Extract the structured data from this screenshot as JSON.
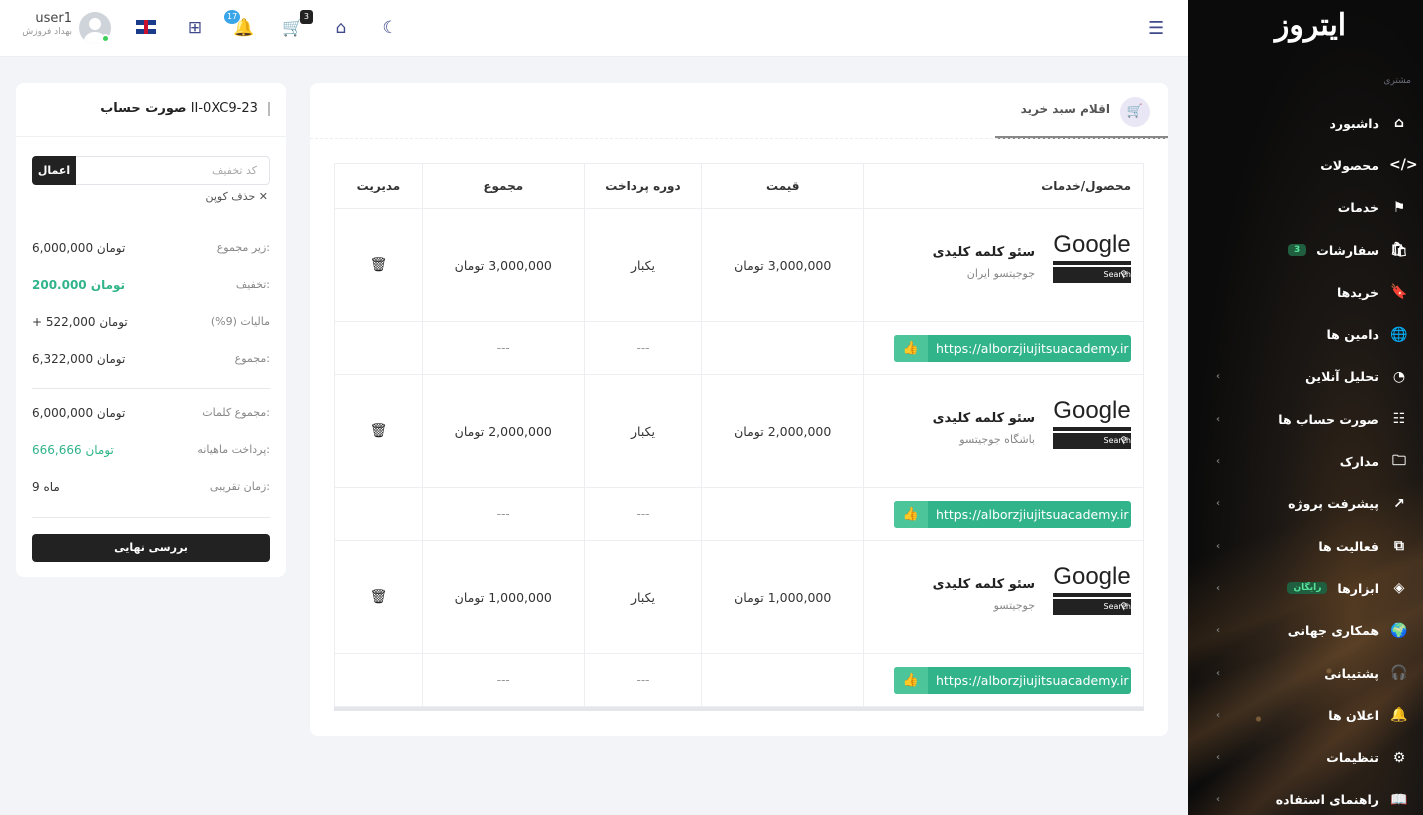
{
  "sidebar": {
    "logo": "ایتروز",
    "section": "مشتری",
    "items": [
      {
        "label": "داشبورد",
        "icon": "⌂",
        "icon_name": "home-icon"
      },
      {
        "label": "محصولات",
        "icon": "</>",
        "icon_name": "code-icon"
      },
      {
        "label": "خدمات",
        "icon": "⚑",
        "icon_name": "flag-icon"
      },
      {
        "label": "سفارشات",
        "icon": "🛍",
        "icon_name": "shopping-bag-icon",
        "badge": "3"
      },
      {
        "label": "خریدها",
        "icon": "🔖",
        "icon_name": "bookmark-icon"
      },
      {
        "label": "دامین ها",
        "icon": "🌐",
        "icon_name": "globe-icon"
      },
      {
        "label": "تحلیل آنلاین",
        "icon": "◔",
        "icon_name": "pie-chart-icon"
      },
      {
        "label": "صورت حساب ها",
        "icon": "☷",
        "icon_name": "invoice-icon"
      },
      {
        "label": "مدارک",
        "icon": "🗀",
        "icon_name": "folder-icon"
      },
      {
        "label": "پیشرفت پروژه",
        "icon": "↗",
        "icon_name": "trending-up-icon"
      },
      {
        "label": "فعالیت ها",
        "icon": "⧉",
        "icon_name": "activity-icon"
      },
      {
        "label": "ابزارها",
        "icon": "◈",
        "icon_name": "layers-icon",
        "badge": "رایگان"
      },
      {
        "label": "همکاری جهانی",
        "icon": "🌍",
        "icon_name": "world-icon"
      },
      {
        "label": "پشتیبانی",
        "icon": "🎧",
        "icon_name": "headset-icon"
      },
      {
        "label": "اعلان ها",
        "icon": "🔔",
        "icon_name": "bell-icon"
      },
      {
        "label": "تنظیمات",
        "icon": "⚙",
        "icon_name": "gear-icon"
      },
      {
        "label": "راهنمای استفاده",
        "icon": "📖",
        "icon_name": "book-icon"
      }
    ]
  },
  "topbar": {
    "cart_count": "3",
    "notif_count": "17",
    "user_name": "user1",
    "user_role": "بهداد فروزش"
  },
  "invoice": {
    "title_prefix": "صورت حساب",
    "invoice_id": "II-0XC9-23",
    "coupon_placeholder": "کد تخفیف",
    "coupon_apply": "اعمال",
    "coupon_remove": "حذف کوپن",
    "rows": [
      {
        "label": "زیر مجموع:",
        "value": "6,000,000 تومان"
      },
      {
        "label": "تخفیف:",
        "value": "200.000 تومان"
      },
      {
        "label": "مالیات (9%)",
        "value": "+ 522,000 تومان"
      },
      {
        "label": "مجموع:",
        "value": "6,322,000 تومان"
      }
    ],
    "rows2": [
      {
        "label": "مجموع کلمات:",
        "value": "6,000,000 تومان"
      },
      {
        "label": "پرداخت ماهیانه:",
        "value": "666,666 تومان"
      },
      {
        "label": "زمان تقریبی:",
        "value": "9 ماه"
      }
    ],
    "final_button": "بررسی نهایی"
  },
  "cart": {
    "tab_label": "اقلام سبد خرید",
    "columns": [
      "محصول/خدمات",
      "قیمت",
      "دوره پرداخت",
      "مجموع",
      "مدیریت"
    ],
    "items": [
      {
        "title": "سئو کلمه کلیدی",
        "subtitle": "جوجیتسو ایران",
        "price": "3,000,000 تومان",
        "period": "یکبار",
        "total": "3,000,000 تومان",
        "url": "https://alborzjiujitsuacademy.ir"
      },
      {
        "title": "سئو کلمه کلیدی",
        "subtitle": "باشگاه جوجیتسو",
        "price": "2,000,000 تومان",
        "period": "یکبار",
        "total": "2,000,000 تومان",
        "url": "https://alborzjiujitsuacademy.ir"
      },
      {
        "title": "سئو کلمه کلیدی",
        "subtitle": "جوجیتسو",
        "price": "1,000,000 تومان",
        "period": "یکبار",
        "total": "1,000,000 تومان",
        "url": "https://alborzjiujitsuacademy.ir"
      }
    ],
    "empty_cell": "---",
    "logo_text": "Google",
    "logo_search": "Search"
  },
  "colors": {
    "accent_green": "#31b48a",
    "dark": "#222222",
    "nav_icon": "#3f4a8a"
  }
}
